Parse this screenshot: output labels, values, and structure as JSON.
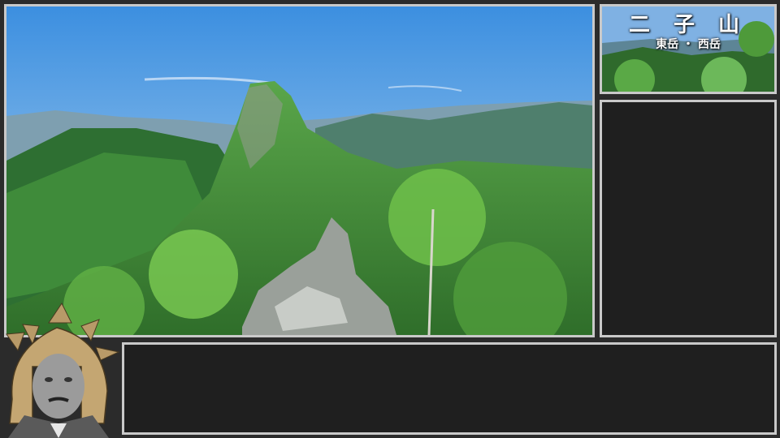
{
  "thumbnail": {
    "title": "二 子 山",
    "subtitle": "東岳 ・ 西岳"
  },
  "main_view": {
    "scene": "mountain-ridge-photo"
  },
  "subtitle_box": {
    "text": ""
  },
  "colors": {
    "frame_border": "#c9c9c9",
    "panel_bg": "#1f1f1f",
    "page_bg": "#2b2b2b"
  }
}
